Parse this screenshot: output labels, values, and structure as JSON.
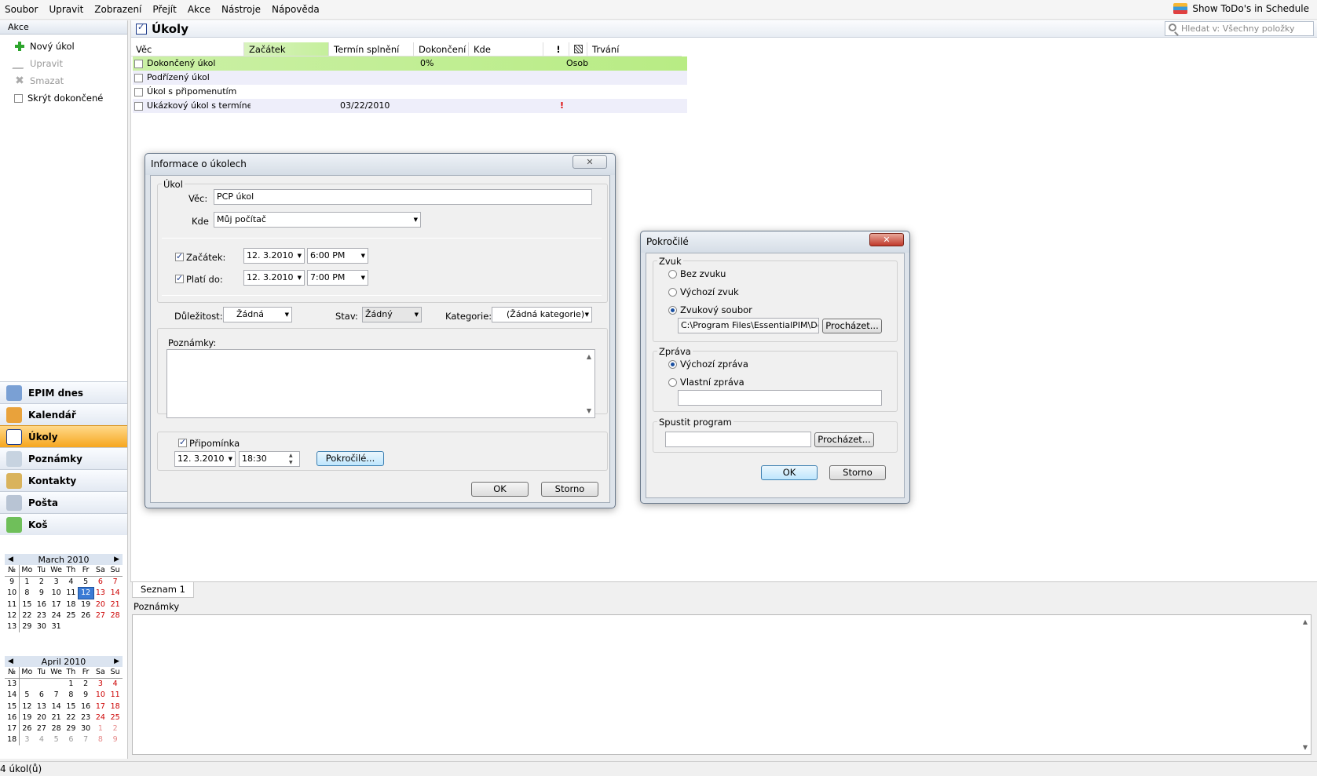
{
  "menu": [
    "Soubor",
    "Upravit",
    "Zobrazení",
    "Přejít",
    "Akce",
    "Nástroje",
    "Nápověda"
  ],
  "todo_link": "Show ToDo's in Schedule",
  "left": {
    "header": "Akce",
    "actions": [
      {
        "label": "Nový úkol",
        "icon": "plus-icon",
        "enabled": true
      },
      {
        "label": "Upravit",
        "icon": "edit-icon",
        "enabled": false
      },
      {
        "label": "Smazat",
        "icon": "delete-icon",
        "enabled": false
      },
      {
        "label": "Skrýt dokončené",
        "icon": "checkbox-icon",
        "enabled": true
      }
    ],
    "nav": [
      {
        "label": "EPIM dnes",
        "icon": "today-icon",
        "color": "#7aa0d4"
      },
      {
        "label": "Kalendář",
        "icon": "calendar-icon",
        "color": "#e9a23b"
      },
      {
        "label": "Úkoly",
        "icon": "tasks-icon",
        "color": "#ffffff",
        "active": true
      },
      {
        "label": "Poznámky",
        "icon": "notes-icon",
        "color": "#c7d3e0"
      },
      {
        "label": "Kontakty",
        "icon": "contacts-icon",
        "color": "#d9b35c"
      },
      {
        "label": "Pošta",
        "icon": "mail-icon",
        "color": "#b8c4d4"
      },
      {
        "label": "Koš",
        "icon": "trash-icon",
        "color": "#6fbf5a"
      }
    ]
  },
  "calendars": [
    {
      "title": "March  2010",
      "dow": [
        "№",
        "Mo",
        "Tu",
        "We",
        "Th",
        "Fr",
        "Sa",
        "Su"
      ],
      "weeks": [
        [
          "9",
          "1",
          "2",
          "3",
          "4",
          "5",
          "6",
          "7"
        ],
        [
          "10",
          "8",
          "9",
          "10",
          "11",
          "12",
          "13",
          "14"
        ],
        [
          "11",
          "15",
          "16",
          "17",
          "18",
          "19",
          "20",
          "21"
        ],
        [
          "12",
          "22",
          "23",
          "24",
          "25",
          "26",
          "27",
          "28"
        ],
        [
          "13",
          "29",
          "30",
          "31",
          "",
          "",
          "",
          ""
        ]
      ],
      "today": "12"
    },
    {
      "title": "April  2010",
      "dow": [
        "№",
        "Mo",
        "Tu",
        "We",
        "Th",
        "Fr",
        "Sa",
        "Su"
      ],
      "weeks": [
        [
          "13",
          "",
          "",
          "",
          "1",
          "2",
          "3",
          "4"
        ],
        [
          "14",
          "5",
          "6",
          "7",
          "8",
          "9",
          "10",
          "11"
        ],
        [
          "15",
          "12",
          "13",
          "14",
          "15",
          "16",
          "17",
          "18"
        ],
        [
          "16",
          "19",
          "20",
          "21",
          "22",
          "23",
          "24",
          "25"
        ],
        [
          "17",
          "26",
          "27",
          "28",
          "29",
          "30",
          "1",
          "2"
        ],
        [
          "18",
          "3",
          "4",
          "5",
          "6",
          "7",
          "8",
          "9"
        ]
      ],
      "today": ""
    }
  ],
  "main": {
    "title": "Úkoly",
    "search_placeholder": "Hledat v: Všechny položky",
    "columns": [
      "Věc",
      "Začátek",
      "Termín splnění",
      "Dokončení",
      "Kde",
      "!",
      "",
      "Trvání"
    ],
    "rows": [
      {
        "subject": "Dokončený úkol",
        "start": "",
        "due": "",
        "done": "0%",
        "where": "",
        "prio": "",
        "duration": "Osob"
      },
      {
        "subject": "Podřízený úkol",
        "start": "",
        "due": "",
        "done": "",
        "where": "",
        "prio": "",
        "duration": ""
      },
      {
        "subject": "Úkol s připomenutím",
        "start": "",
        "due": "",
        "done": "",
        "where": "",
        "prio": "",
        "duration": ""
      },
      {
        "subject": "Ukázkový úkol s termínem c",
        "start": "",
        "due": "03/22/2010",
        "done": "",
        "where": "",
        "prio": "!",
        "duration": ""
      }
    ],
    "tab": "Seznam 1",
    "notes_label": "Poznámky"
  },
  "status": "4 úkol(ů)",
  "task_dialog": {
    "title": "Informace o úkolech",
    "close": "✕",
    "group_label": "Úkol",
    "subject_label": "Věc:",
    "subject_value": "PCP úkol",
    "where_label": "Kde",
    "where_value": "Můj počítač",
    "start_label": "Začátek:",
    "start_date": "12.  3.2010",
    "start_time": "6:00 PM",
    "due_label": "Platí do:",
    "due_date": "12.  3.2010",
    "due_time": "7:00 PM",
    "priority_label": "Důležitost:",
    "priority_value": "Žádná",
    "status_label": "Stav:",
    "status_value": "Žádný",
    "category_label": "Kategorie:",
    "category_value": "(Žádná kategorie)",
    "notes_label": "Poznámky:",
    "reminder_label": "Připomínka",
    "reminder_date": "12.  3.2010",
    "reminder_time": "18:30",
    "advanced_button": "Pokročilé...",
    "ok": "OK",
    "cancel": "Storno"
  },
  "adv_dialog": {
    "title": "Pokročilé",
    "close": "✕",
    "sound_group": "Zvuk",
    "sound_options": [
      "Bez zvuku",
      "Výchozí zvuk",
      "Zvukový soubor"
    ],
    "sound_selected": 2,
    "sound_file": "C:\\Program Files\\EssentialPIM\\Default",
    "browse": "Procházet...",
    "message_group": "Zpráva",
    "message_options": [
      "Výchozí zpráva",
      "Vlastní zpráva"
    ],
    "message_selected": 0,
    "custom_message": "",
    "program_group": "Spustit program",
    "program_value": "",
    "browse2": "Procházet...",
    "ok": "OK",
    "cancel": "Storno"
  }
}
